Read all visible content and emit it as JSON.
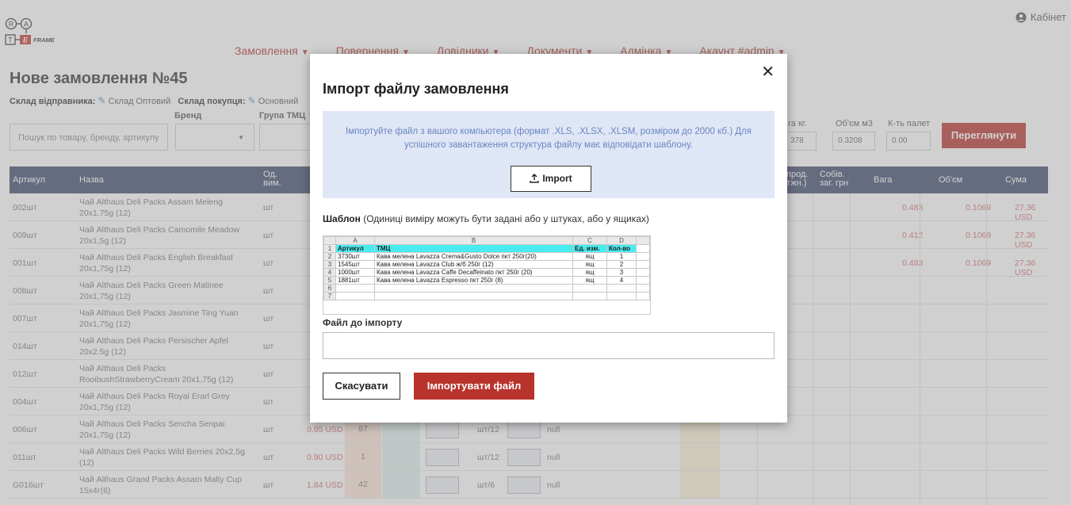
{
  "header": {
    "logo_text": "FRAME",
    "cabinet": "Кабінет"
  },
  "nav": [
    {
      "label": "Замовлення"
    },
    {
      "label": "Повернення"
    },
    {
      "label": "Довідники"
    },
    {
      "label": "Документи"
    },
    {
      "label": "Адмінка"
    },
    {
      "label": "Акаунт #admin"
    }
  ],
  "page": {
    "title": "Нове замовлення №45",
    "sender_label": "Склад відправника:",
    "sender_value": "Склад Оптовий",
    "buyer_label": "Склад покупця:",
    "buyer_value": "Основний",
    "brand_label": "Бренд",
    "group_label": "Група ТМЦ",
    "search_placeholder": "Пошук по товару, бренду, артикулу",
    "weight_label": "га кг.",
    "weight_value": "378",
    "volume_label": "Об'єм м3",
    "volume_value": "0.3208",
    "pallets_label": "К-ть палет",
    "pallets_value": "0.00",
    "view_button": "Переглянути"
  },
  "table": {
    "headers": {
      "article": "Артикул",
      "name": "Назва",
      "unit": "Од. вим.",
      "prod": "прод. тжн.)",
      "cost": "Собів. заг. грн",
      "weight": "Вага",
      "volume": "Об'єм",
      "sum": "Сума"
    },
    "rows": [
      {
        "article": "002шт",
        "name": "Чай Althaus Deli Packs Assam Meleng 20x1.75g (12)",
        "unit": "шт",
        "price": "",
        "stock": "",
        "pack": "",
        "null": "",
        "weight": "0.483",
        "volume": "0.1069",
        "sum": "27.36 USD"
      },
      {
        "article": "009шт",
        "name": "Чай Althaus Deli Packs Camomile Meadow 20x1,5g (12)",
        "unit": "шт",
        "price": "",
        "stock": "",
        "pack": "",
        "null": "",
        "weight": "0.412",
        "volume": "0.1069",
        "sum": "27.36 USD"
      },
      {
        "article": "001шт",
        "name": "Чай Althaus Deli Packs English Breakfast 20x1,75g (12)",
        "unit": "шт",
        "price": "",
        "stock": "",
        "pack": "",
        "null": "",
        "weight": "0.483",
        "volume": "0.1069",
        "sum": "27.36 USD"
      },
      {
        "article": "008шт",
        "name": "Чай Althaus Deli Packs Green Matinee 20x1,75g (12)",
        "unit": "шт",
        "price": "",
        "stock": "",
        "pack": "",
        "null": "",
        "weight": "",
        "volume": "",
        "sum": ""
      },
      {
        "article": "007шт",
        "name": "Чай Althaus Deli Packs Jasmine Ting Yuan 20x1,75g (12)",
        "unit": "шт",
        "price": "",
        "stock": "",
        "pack": "",
        "null": "",
        "weight": "",
        "volume": "",
        "sum": ""
      },
      {
        "article": "014шт",
        "name": "Чай Althaus Deli Packs Persischer Apfel 20x2.5g (12)",
        "unit": "шт",
        "price": "",
        "stock": "",
        "pack": "",
        "null": "",
        "weight": "",
        "volume": "",
        "sum": ""
      },
      {
        "article": "012шт",
        "name": "Чай Althaus Deli Packs RooibushStrawberryCream 20x1,75g (12)",
        "unit": "шт",
        "price": "",
        "stock": "",
        "pack": "",
        "null": "",
        "weight": "",
        "volume": "",
        "sum": ""
      },
      {
        "article": "004шт",
        "name": "Чай Althaus Deli Packs Royal Erarl Grey 20x1,75g (12)",
        "unit": "шт",
        "price": "",
        "stock": "",
        "pack": "",
        "null": "",
        "weight": "",
        "volume": "",
        "sum": ""
      },
      {
        "article": "006шт",
        "name": "Чай Althaus Deli Packs Sencha Senpai 20x1,75g (12)",
        "unit": "шт",
        "price": "0.95 USD",
        "stock": "87",
        "pack": "шт/12",
        "null": "null",
        "weight": "",
        "volume": "",
        "sum": ""
      },
      {
        "article": "011шт",
        "name": "Чай Althaus Deli Packs Wild Berries 20x2,5g (12)",
        "unit": "шт",
        "price": "0.90 USD",
        "stock": "1",
        "pack": "шт/12",
        "null": "null",
        "weight": "",
        "volume": "",
        "sum": ""
      },
      {
        "article": "G016шт",
        "name": "Чай Althaus Grand Packs Assam Malty Cup 15x4г(6)",
        "unit": "шт",
        "price": "1.84 USD",
        "stock": "42",
        "pack": "шт/6",
        "null": "null",
        "weight": "",
        "volume": "",
        "sum": ""
      }
    ]
  },
  "modal": {
    "title": "Імпорт файлу замовлення",
    "info_text": "Імпортуйте файл з вашого компьютера (формат .XLS, .XLSX, .XLSM, розміром до 2000 кб.) Для успішного завантаження структура файлу має відповідати шаблону.",
    "import_button": "Import",
    "template_label": "Шаблон",
    "template_hint": "(Одиниці виміру можуть бути задані або у штуках, або у ящиках)",
    "template_sheet": {
      "col_letters": [
        "A",
        "B",
        "C",
        "D"
      ],
      "headers": [
        "Артикул",
        "ТМЦ",
        "Ед. изм.",
        "Кол-во"
      ],
      "rows": [
        [
          "3730шт",
          "Кава мелена Lavazza Crema&Gusto Dolce пкт 250г(20)",
          "ящ",
          "1"
        ],
        [
          "1545шт",
          "Кава мелена Lavazza Club ж/б 250г (12)",
          "ящ",
          "2"
        ],
        [
          "1000шт",
          "Кава мелена Lavazza Caffe Decaffeinato пкт 250г (20)",
          "ящ",
          "3"
        ],
        [
          "1881шт",
          "Кава мелена Lavazza Espresso пкт 250г (8)",
          "ящ",
          "4"
        ]
      ],
      "row_numbers": [
        "1",
        "2",
        "3",
        "4",
        "5",
        "6",
        "7"
      ]
    },
    "file_label": "Файл до імпорту",
    "cancel_button": "Скасувати",
    "submit_button": "Імпортувати файл"
  },
  "colors": {
    "accent": "#b8332c",
    "table_header": "#3f4a6e",
    "info_bg": "#dfe6f6",
    "info_text": "#6a86c2"
  }
}
